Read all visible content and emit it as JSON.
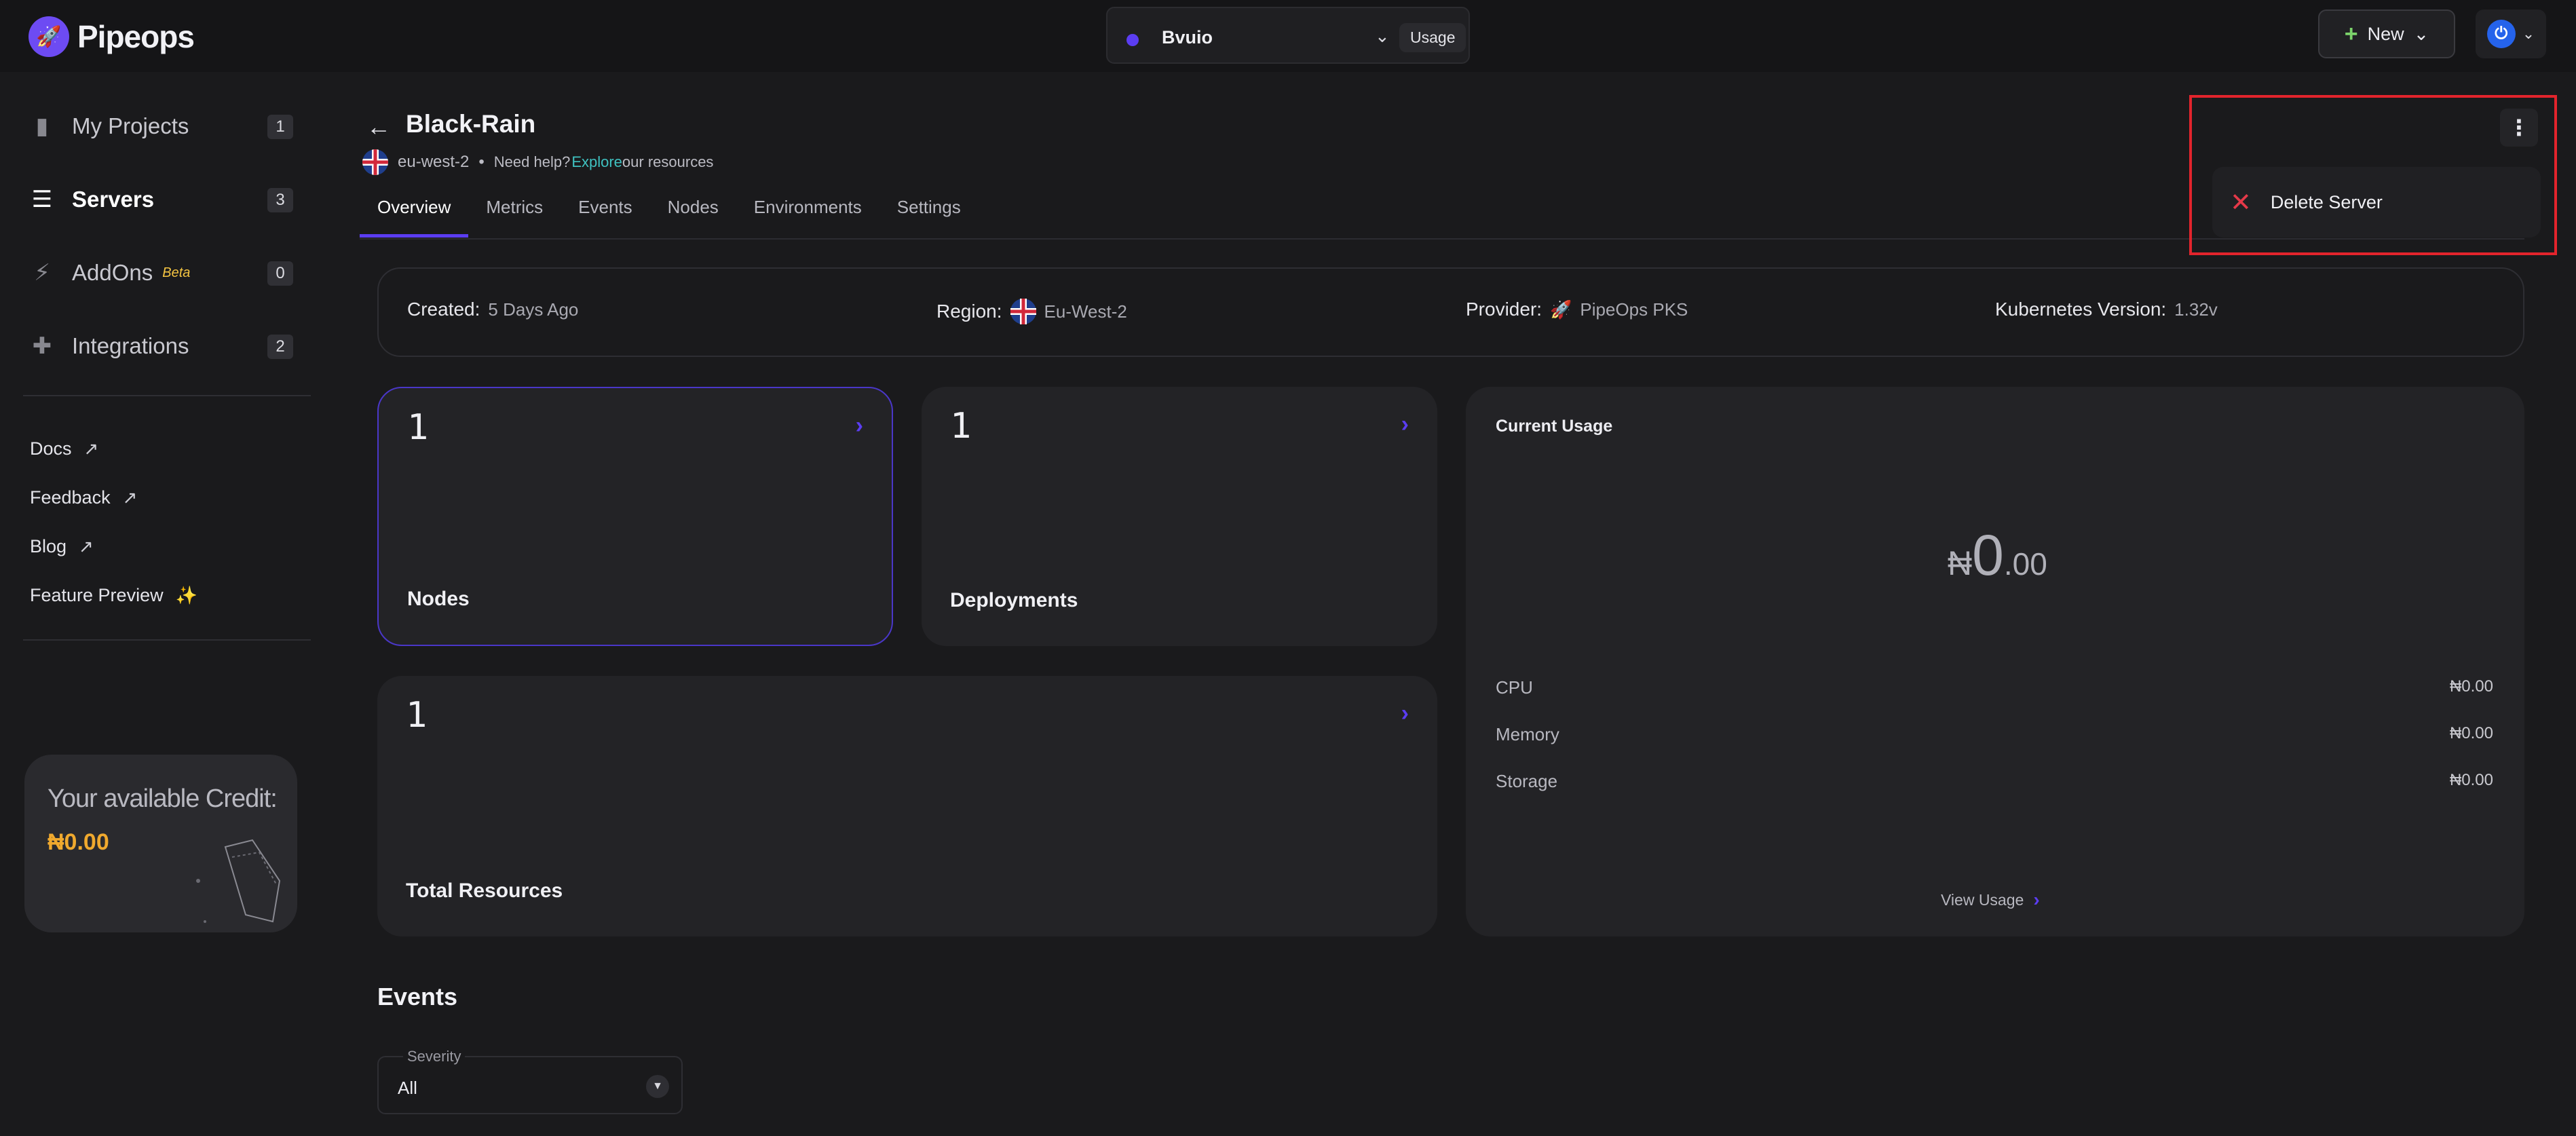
{
  "app": {
    "name": "Pipeops"
  },
  "workspace": {
    "name": "Bvuio",
    "usage_label": "Usage"
  },
  "header": {
    "new_label": "New"
  },
  "sidebar": {
    "items": [
      {
        "label": "My Projects",
        "count": "1"
      },
      {
        "label": "Servers",
        "count": "3"
      },
      {
        "label": "AddOns",
        "badge": "Beta",
        "count": "0"
      },
      {
        "label": "Integrations",
        "count": "2"
      }
    ],
    "links": [
      "Docs",
      "Feedback",
      "Blog",
      "Feature Preview"
    ],
    "credit": {
      "title": "Your available Credit:",
      "value": "₦0.00"
    }
  },
  "server": {
    "name": "Black-Rain",
    "region_code": "eu-west-2",
    "help_text": "Need help?",
    "help_link": "Explore",
    "help_suffix": "our resources"
  },
  "tabs": [
    "Overview",
    "Metrics",
    "Events",
    "Nodes",
    "Environments",
    "Settings"
  ],
  "info": {
    "created_label": "Created:",
    "created_value": "5 Days Ago",
    "region_label": "Region:",
    "region_value": "Eu-West-2",
    "provider_label": "Provider:",
    "provider_value": "PipeOps PKS",
    "k8s_label": "Kubernetes Version:",
    "k8s_value": "1.32v"
  },
  "cards": {
    "nodes": {
      "value": "1",
      "label": "Nodes"
    },
    "deployments": {
      "value": "1",
      "label": "Deployments"
    },
    "resources": {
      "value": "1",
      "label": "Total Resources"
    }
  },
  "usage": {
    "title": "Current Usage",
    "currency": "₦",
    "amount_major": "0",
    "amount_minor": ".00",
    "rows": [
      {
        "label": "CPU",
        "value": "₦0.00"
      },
      {
        "label": "Memory",
        "value": "₦0.00"
      },
      {
        "label": "Storage",
        "value": "₦0.00"
      }
    ],
    "view_label": "View Usage"
  },
  "events": {
    "title": "Events",
    "severity_label": "Severity",
    "severity_value": "All"
  },
  "menu": {
    "delete_label": "Delete Server"
  },
  "colors": {
    "accent": "#5b3df2",
    "danger": "#e53949",
    "credit": "#f0a92e",
    "link": "#3fc1c0"
  }
}
